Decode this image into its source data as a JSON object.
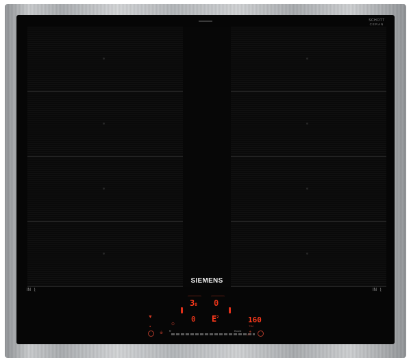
{
  "product": {
    "brand": "SIEMENS",
    "glass_label_line1": "SCHOTT",
    "glass_label_line2": "CERAN"
  },
  "zones": {
    "left_indicator": "IN",
    "right_indicator": "IN",
    "flex_icon": "flex-zone-icon"
  },
  "displays": {
    "left_upper": "3",
    "left_upper_sub": "8",
    "right_upper": "0",
    "left_lower": "0",
    "right_lower": "E",
    "right_lower_sup": "2",
    "timer": "160",
    "mode_label": "TIM"
  },
  "slider": {
    "min_label": "0",
    "boost_label": "Boost"
  },
  "colors": {
    "frame": "#b8bbbe",
    "glass": "#060606",
    "led": "#ff3a1c",
    "brand_text": "#ececec"
  },
  "icons": [
    "power-icon",
    "timer-icon",
    "lock-icon",
    "flex-zone-icon",
    "arrow-up-icon",
    "arrow-down-icon"
  ]
}
